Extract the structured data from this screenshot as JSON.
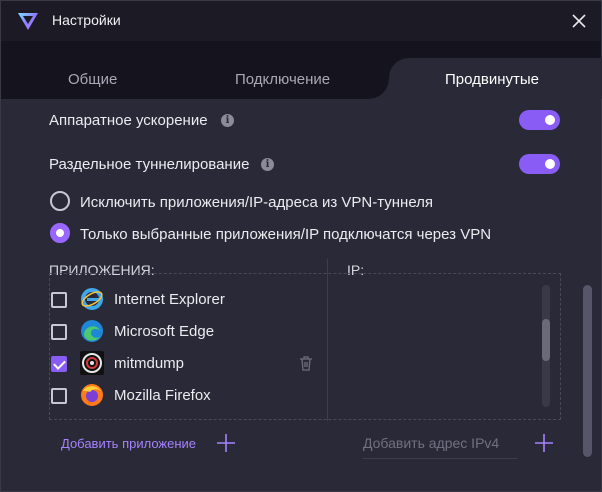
{
  "window": {
    "title": "Настройки"
  },
  "tabs": [
    {
      "label": "Общие"
    },
    {
      "label": "Подключение"
    },
    {
      "label": "Продвинутые"
    }
  ],
  "settings": {
    "hw_accel": {
      "label": "Аппаратное ускорение",
      "enabled": true
    },
    "split_tunnel": {
      "label": "Раздельное туннелирование",
      "enabled": true
    }
  },
  "radios": [
    {
      "label": "Исключить приложения/IP-адреса из VPN-туннеля",
      "selected": false
    },
    {
      "label": "Только выбранные приложения/IP подключатся через VPN",
      "selected": true
    }
  ],
  "columns": {
    "apps": "ПРИЛОЖЕНИЯ:",
    "ip": "IP:"
  },
  "apps": [
    {
      "name": "Internet Explorer",
      "checked": false,
      "icon": "internet-explorer-icon"
    },
    {
      "name": "Microsoft Edge",
      "checked": false,
      "icon": "microsoft-edge-icon"
    },
    {
      "name": "mitmdump",
      "checked": true,
      "icon": "mitmdump-icon"
    },
    {
      "name": "Mozilla Firefox",
      "checked": false,
      "icon": "firefox-icon"
    }
  ],
  "actions": {
    "add_app": "Добавить приложение",
    "ip_placeholder": "Добавить адрес IPv4"
  },
  "colors": {
    "accent": "#8a5cf6",
    "link": "#a582ff",
    "background": "#2a2937"
  }
}
